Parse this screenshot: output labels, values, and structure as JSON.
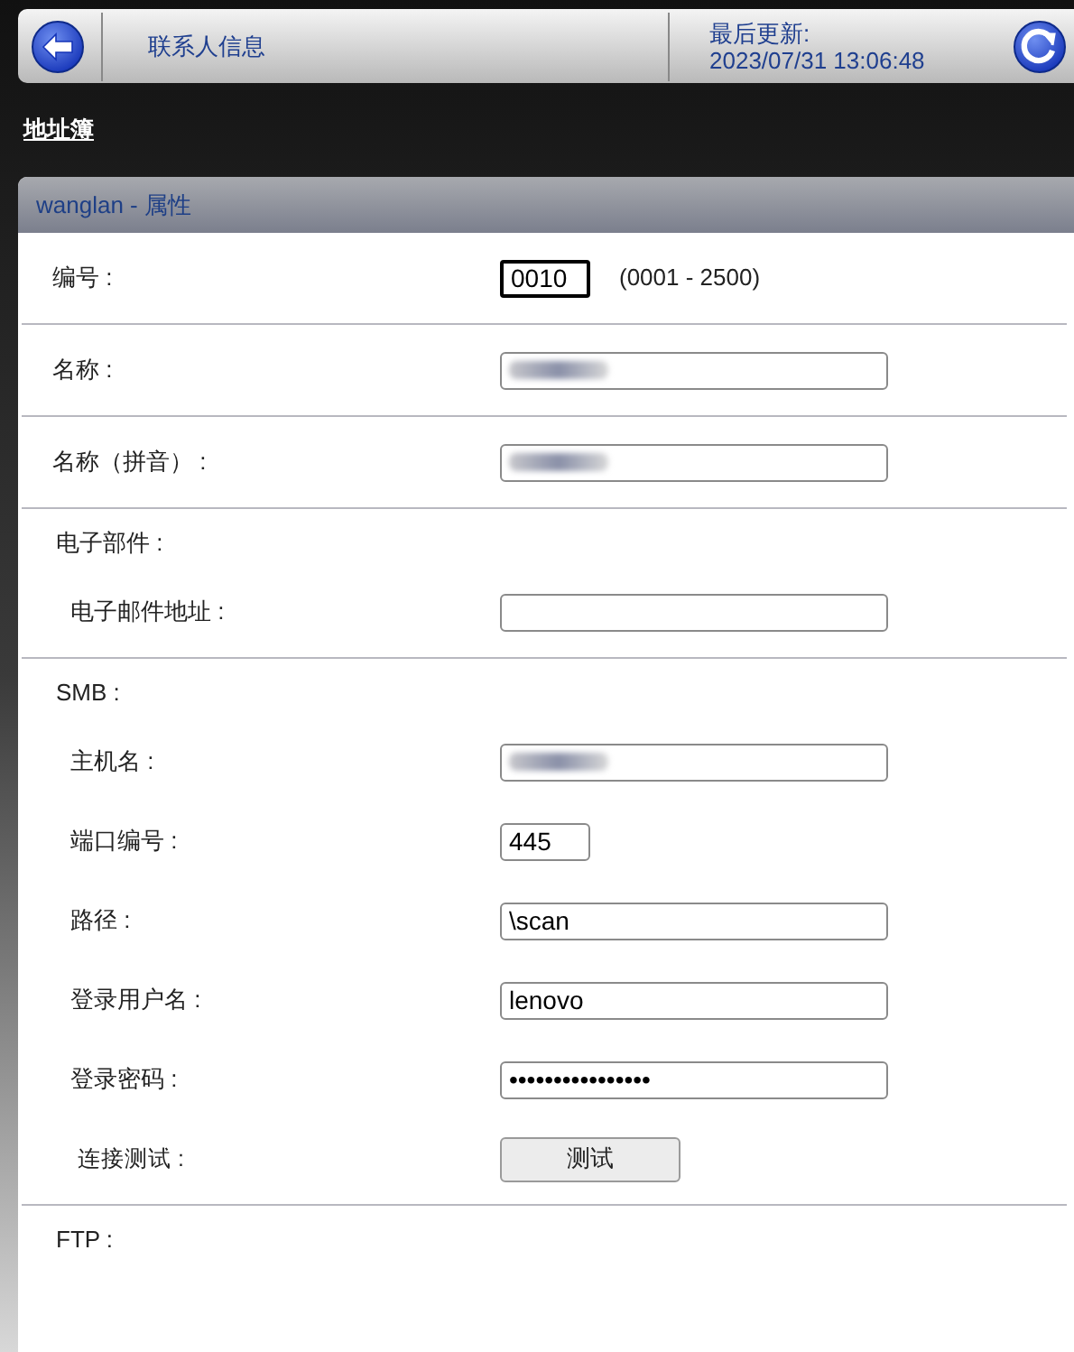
{
  "header": {
    "title": "联系人信息",
    "updated_label": "最后更新:",
    "updated_time": "2023/07/31 13:06:48"
  },
  "breadcrumb": "地址簿",
  "panel": {
    "title": "wanglan - 属性",
    "sections": [
      {
        "rows": [
          {
            "label": "编号 :",
            "kind": "short",
            "value": "0010",
            "focused": true,
            "blurred": false,
            "hint": "(0001 - 2500)"
          }
        ]
      },
      {
        "rows": [
          {
            "label": "名称 :",
            "kind": "text",
            "focused": false,
            "blurred": true
          }
        ]
      },
      {
        "rows": [
          {
            "label": "名称（拼音）  :",
            "kind": "text",
            "focused": false,
            "blurred": true
          }
        ]
      },
      {
        "heading": "电子部件 :",
        "rows": [
          {
            "label": "电子邮件地址 :",
            "kind": "text",
            "focused": false,
            "blurred": false
          }
        ]
      },
      {
        "heading": "SMB :",
        "rows": [
          {
            "label": "主机名 :",
            "kind": "text",
            "focused": false,
            "blurred": true
          },
          {
            "label": "端口编号 :",
            "kind": "short",
            "value": "445",
            "focused": false,
            "blurred": false
          },
          {
            "label": "路径 :",
            "kind": "text",
            "value": "\\scan",
            "focused": false,
            "blurred": false
          },
          {
            "label": "登录用户名 :",
            "kind": "text",
            "value": "lenovo",
            "focused": false,
            "blurred": false
          },
          {
            "label": "登录密码 :",
            "kind": "text",
            "value": "••••••••••••••••",
            "focused": false,
            "blurred": false
          },
          {
            "label": "连接测试 :",
            "kind": "button",
            "value": "测试"
          }
        ]
      },
      {
        "heading": "FTP :"
      }
    ]
  }
}
